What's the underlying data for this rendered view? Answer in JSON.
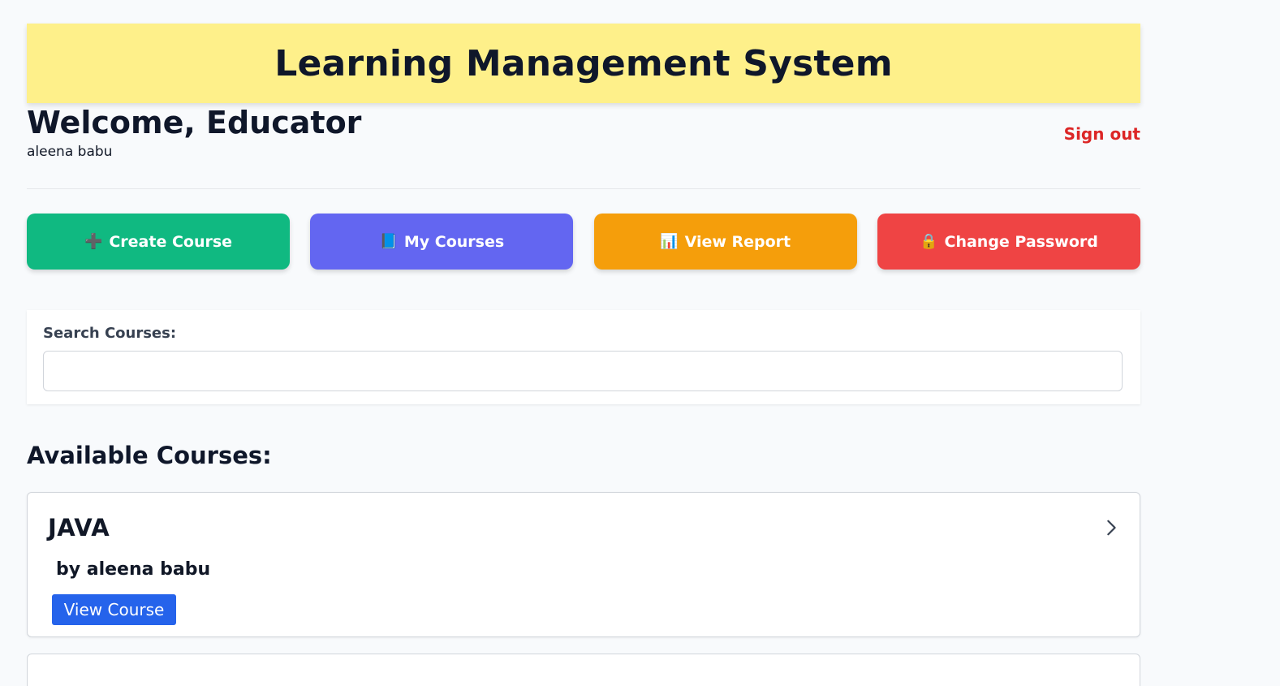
{
  "app": {
    "title": "Learning Management System"
  },
  "header": {
    "welcome": "Welcome, Educator",
    "username": "aleena babu",
    "signout_label": "Sign out"
  },
  "actions": [
    {
      "icon": "plus-icon",
      "glyph": "➕",
      "label": "Create Course",
      "color": "#10b981"
    },
    {
      "icon": "book-icon",
      "glyph": "📘",
      "label": "My Courses",
      "color": "#6366f1"
    },
    {
      "icon": "bar-chart-icon",
      "glyph": "📊",
      "label": "View Report",
      "color": "#f59e0b"
    },
    {
      "icon": "lock-icon",
      "glyph": "🔒",
      "label": "Change Password",
      "color": "#ef4444"
    }
  ],
  "search": {
    "label": "Search Courses:",
    "value": "",
    "placeholder": ""
  },
  "courses_section": {
    "title": "Available Courses:",
    "items": [
      {
        "title": "JAVA",
        "author": "by aleena babu",
        "button_label": "View Course"
      }
    ]
  },
  "colors": {
    "banner": "#fef08a",
    "signout": "#dc2626",
    "view_button": "#2563eb"
  }
}
